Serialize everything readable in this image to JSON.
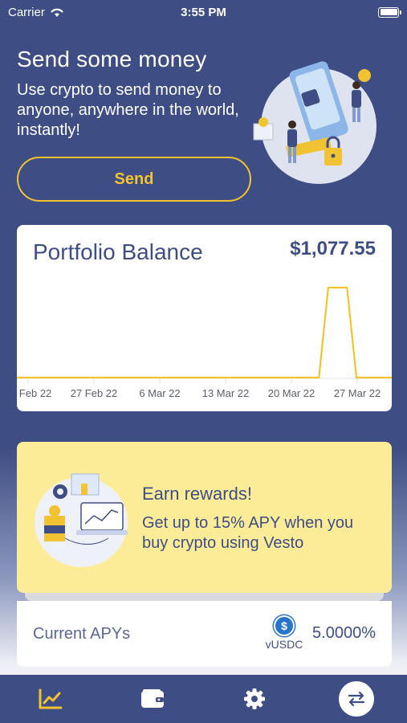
{
  "status_bar": {
    "carrier": "Carrier",
    "time": "3:55 PM"
  },
  "hero": {
    "title": "Send some money",
    "subtitle": "Use crypto to send money to anyone, anywhere in the world, instantly!",
    "send_label": "Send"
  },
  "portfolio": {
    "title": "Portfolio Balance",
    "balance": "$1,077.55"
  },
  "chart_data": {
    "type": "line",
    "x": [
      "20 Feb 22",
      "27 Feb 22",
      "6 Mar 22",
      "13 Mar 22",
      "20 Mar 22",
      "27 Mar 22"
    ],
    "tick_labels": [
      "20 Feb 22",
      "27 Feb 22",
      "6 Mar 22",
      "13 Mar 22",
      "20 Mar 22",
      "27 Mar 22"
    ],
    "series": [
      {
        "points": [
          [
            "2022-02-20",
            0
          ],
          [
            "2022-02-27",
            0
          ],
          [
            "2022-03-06",
            0
          ],
          [
            "2022-03-13",
            0
          ],
          [
            "2022-03-20",
            0
          ],
          [
            "2022-03-23",
            0
          ],
          [
            "2022-03-24",
            1077.55
          ],
          [
            "2022-03-26",
            1077.55
          ],
          [
            "2022-03-27",
            0
          ],
          [
            "2022-03-30",
            0
          ]
        ]
      }
    ],
    "line_color": "#f1c232",
    "grid": false
  },
  "rewards": {
    "title": "Earn rewards!",
    "subtitle": "Get up to 15% APY when you buy crypto using Vesto"
  },
  "apy": {
    "label": "Current APYs",
    "coin_symbol": "$",
    "coin_name": "vUSDC",
    "value": "5.0000%"
  },
  "tab_bar": {
    "tabs": [
      {
        "icon": "chart-icon",
        "active": true
      },
      {
        "icon": "wallet-icon",
        "active": false
      },
      {
        "icon": "gear-icon",
        "active": false
      },
      {
        "icon": "swap-icon",
        "active": false
      }
    ]
  },
  "colors": {
    "primary": "#3e4e84",
    "accent": "#f1c232",
    "rewards_bg": "#fcec98",
    "coin": "#2775ca"
  }
}
